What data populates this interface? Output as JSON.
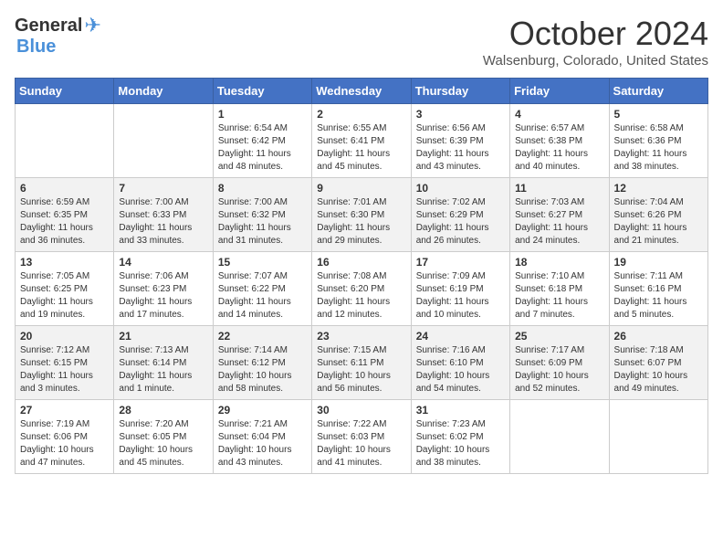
{
  "logo": {
    "general": "General",
    "blue": "Blue"
  },
  "title": {
    "month": "October 2024",
    "location": "Walsenburg, Colorado, United States"
  },
  "headers": [
    "Sunday",
    "Monday",
    "Tuesday",
    "Wednesday",
    "Thursday",
    "Friday",
    "Saturday"
  ],
  "weeks": [
    [
      {
        "day": "",
        "sunrise": "",
        "sunset": "",
        "daylight": ""
      },
      {
        "day": "",
        "sunrise": "",
        "sunset": "",
        "daylight": ""
      },
      {
        "day": "1",
        "sunrise": "Sunrise: 6:54 AM",
        "sunset": "Sunset: 6:42 PM",
        "daylight": "Daylight: 11 hours and 48 minutes."
      },
      {
        "day": "2",
        "sunrise": "Sunrise: 6:55 AM",
        "sunset": "Sunset: 6:41 PM",
        "daylight": "Daylight: 11 hours and 45 minutes."
      },
      {
        "day": "3",
        "sunrise": "Sunrise: 6:56 AM",
        "sunset": "Sunset: 6:39 PM",
        "daylight": "Daylight: 11 hours and 43 minutes."
      },
      {
        "day": "4",
        "sunrise": "Sunrise: 6:57 AM",
        "sunset": "Sunset: 6:38 PM",
        "daylight": "Daylight: 11 hours and 40 minutes."
      },
      {
        "day": "5",
        "sunrise": "Sunrise: 6:58 AM",
        "sunset": "Sunset: 6:36 PM",
        "daylight": "Daylight: 11 hours and 38 minutes."
      }
    ],
    [
      {
        "day": "6",
        "sunrise": "Sunrise: 6:59 AM",
        "sunset": "Sunset: 6:35 PM",
        "daylight": "Daylight: 11 hours and 36 minutes."
      },
      {
        "day": "7",
        "sunrise": "Sunrise: 7:00 AM",
        "sunset": "Sunset: 6:33 PM",
        "daylight": "Daylight: 11 hours and 33 minutes."
      },
      {
        "day": "8",
        "sunrise": "Sunrise: 7:00 AM",
        "sunset": "Sunset: 6:32 PM",
        "daylight": "Daylight: 11 hours and 31 minutes."
      },
      {
        "day": "9",
        "sunrise": "Sunrise: 7:01 AM",
        "sunset": "Sunset: 6:30 PM",
        "daylight": "Daylight: 11 hours and 29 minutes."
      },
      {
        "day": "10",
        "sunrise": "Sunrise: 7:02 AM",
        "sunset": "Sunset: 6:29 PM",
        "daylight": "Daylight: 11 hours and 26 minutes."
      },
      {
        "day": "11",
        "sunrise": "Sunrise: 7:03 AM",
        "sunset": "Sunset: 6:27 PM",
        "daylight": "Daylight: 11 hours and 24 minutes."
      },
      {
        "day": "12",
        "sunrise": "Sunrise: 7:04 AM",
        "sunset": "Sunset: 6:26 PM",
        "daylight": "Daylight: 11 hours and 21 minutes."
      }
    ],
    [
      {
        "day": "13",
        "sunrise": "Sunrise: 7:05 AM",
        "sunset": "Sunset: 6:25 PM",
        "daylight": "Daylight: 11 hours and 19 minutes."
      },
      {
        "day": "14",
        "sunrise": "Sunrise: 7:06 AM",
        "sunset": "Sunset: 6:23 PM",
        "daylight": "Daylight: 11 hours and 17 minutes."
      },
      {
        "day": "15",
        "sunrise": "Sunrise: 7:07 AM",
        "sunset": "Sunset: 6:22 PM",
        "daylight": "Daylight: 11 hours and 14 minutes."
      },
      {
        "day": "16",
        "sunrise": "Sunrise: 7:08 AM",
        "sunset": "Sunset: 6:20 PM",
        "daylight": "Daylight: 11 hours and 12 minutes."
      },
      {
        "day": "17",
        "sunrise": "Sunrise: 7:09 AM",
        "sunset": "Sunset: 6:19 PM",
        "daylight": "Daylight: 11 hours and 10 minutes."
      },
      {
        "day": "18",
        "sunrise": "Sunrise: 7:10 AM",
        "sunset": "Sunset: 6:18 PM",
        "daylight": "Daylight: 11 hours and 7 minutes."
      },
      {
        "day": "19",
        "sunrise": "Sunrise: 7:11 AM",
        "sunset": "Sunset: 6:16 PM",
        "daylight": "Daylight: 11 hours and 5 minutes."
      }
    ],
    [
      {
        "day": "20",
        "sunrise": "Sunrise: 7:12 AM",
        "sunset": "Sunset: 6:15 PM",
        "daylight": "Daylight: 11 hours and 3 minutes."
      },
      {
        "day": "21",
        "sunrise": "Sunrise: 7:13 AM",
        "sunset": "Sunset: 6:14 PM",
        "daylight": "Daylight: 11 hours and 1 minute."
      },
      {
        "day": "22",
        "sunrise": "Sunrise: 7:14 AM",
        "sunset": "Sunset: 6:12 PM",
        "daylight": "Daylight: 10 hours and 58 minutes."
      },
      {
        "day": "23",
        "sunrise": "Sunrise: 7:15 AM",
        "sunset": "Sunset: 6:11 PM",
        "daylight": "Daylight: 10 hours and 56 minutes."
      },
      {
        "day": "24",
        "sunrise": "Sunrise: 7:16 AM",
        "sunset": "Sunset: 6:10 PM",
        "daylight": "Daylight: 10 hours and 54 minutes."
      },
      {
        "day": "25",
        "sunrise": "Sunrise: 7:17 AM",
        "sunset": "Sunset: 6:09 PM",
        "daylight": "Daylight: 10 hours and 52 minutes."
      },
      {
        "day": "26",
        "sunrise": "Sunrise: 7:18 AM",
        "sunset": "Sunset: 6:07 PM",
        "daylight": "Daylight: 10 hours and 49 minutes."
      }
    ],
    [
      {
        "day": "27",
        "sunrise": "Sunrise: 7:19 AM",
        "sunset": "Sunset: 6:06 PM",
        "daylight": "Daylight: 10 hours and 47 minutes."
      },
      {
        "day": "28",
        "sunrise": "Sunrise: 7:20 AM",
        "sunset": "Sunset: 6:05 PM",
        "daylight": "Daylight: 10 hours and 45 minutes."
      },
      {
        "day": "29",
        "sunrise": "Sunrise: 7:21 AM",
        "sunset": "Sunset: 6:04 PM",
        "daylight": "Daylight: 10 hours and 43 minutes."
      },
      {
        "day": "30",
        "sunrise": "Sunrise: 7:22 AM",
        "sunset": "Sunset: 6:03 PM",
        "daylight": "Daylight: 10 hours and 41 minutes."
      },
      {
        "day": "31",
        "sunrise": "Sunrise: 7:23 AM",
        "sunset": "Sunset: 6:02 PM",
        "daylight": "Daylight: 10 hours and 38 minutes."
      },
      {
        "day": "",
        "sunrise": "",
        "sunset": "",
        "daylight": ""
      },
      {
        "day": "",
        "sunrise": "",
        "sunset": "",
        "daylight": ""
      }
    ]
  ]
}
